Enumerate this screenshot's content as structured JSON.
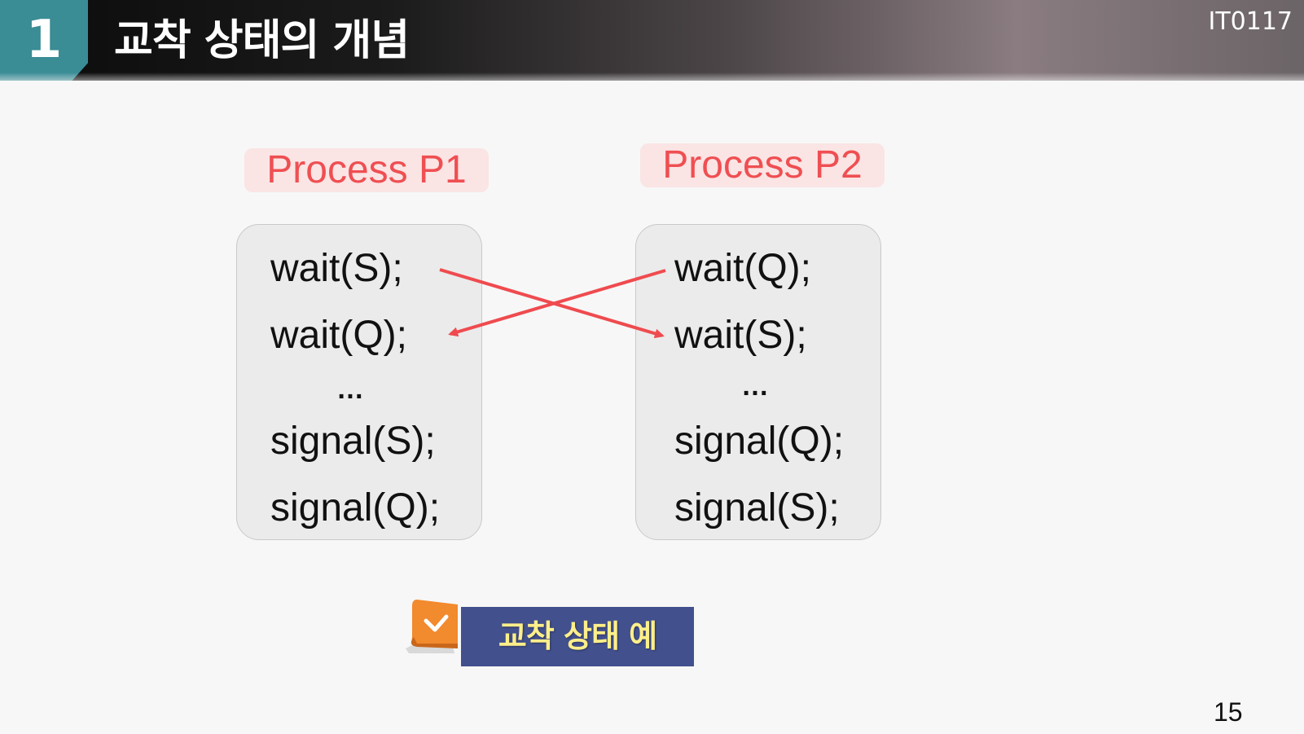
{
  "header": {
    "number": "1",
    "title": "교착 상태의 개념",
    "course_code": "IT0117"
  },
  "process1": {
    "label": "Process P1",
    "lines": [
      "wait(S);",
      "wait(Q);",
      "…",
      "signal(S);",
      "signal(Q);"
    ]
  },
  "process2": {
    "label": "Process P2",
    "lines": [
      "wait(Q);",
      "wait(S);",
      "…",
      "signal(Q);",
      "signal(S);"
    ]
  },
  "caption": "교착 상태 예",
  "page_number": "15",
  "colors": {
    "accent_teal": "#3a8c95",
    "process_label_text": "#ef4f52",
    "process_label_bg": "#fbe4e4",
    "arrow": "#ef4b4f",
    "caption_bg": "#42508e",
    "caption_text": "#ffef8a",
    "ribbon": "#f28a2e"
  }
}
